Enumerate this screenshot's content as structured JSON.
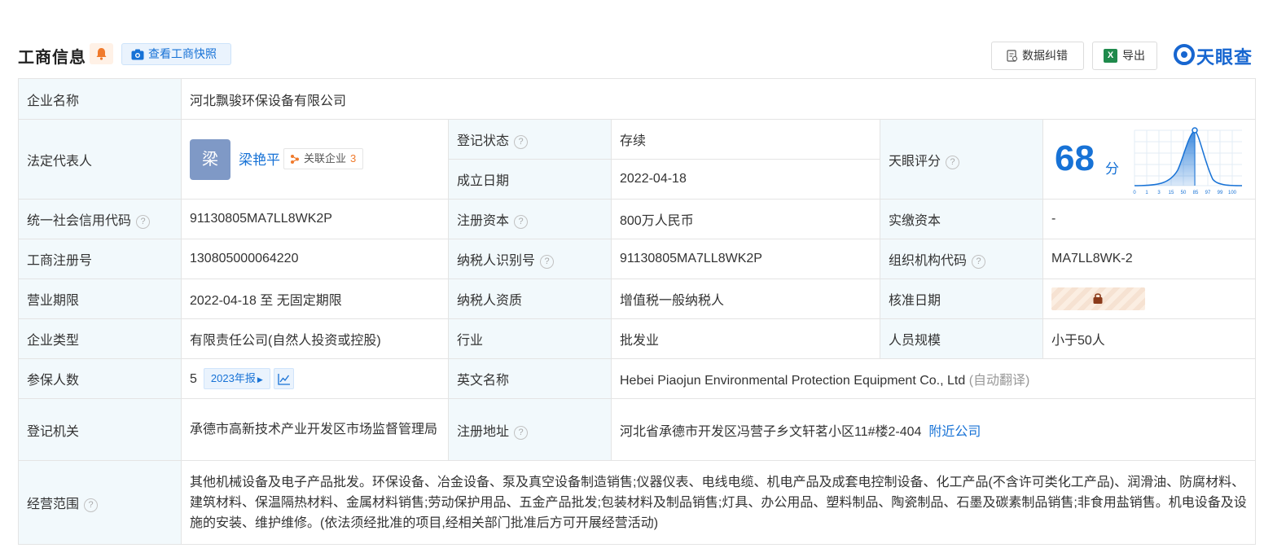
{
  "header": {
    "title": "工商信息",
    "snapshot_button": "查看工商快照",
    "correct_button": "数据纠错",
    "export_button": "导出",
    "export_icon_text": "X",
    "logo_text": "天眼查"
  },
  "company": {
    "name_label": "企业名称",
    "name": "河北飘骏环保设备有限公司",
    "legal_rep_label": "法定代表人",
    "legal_rep_avatar": "梁",
    "legal_rep_name": "梁艳平",
    "related_label": "关联企业",
    "related_count": "3",
    "status_label": "登记状态",
    "status": "存续",
    "found_date_label": "成立日期",
    "found_date": "2022-04-18",
    "score_label": "天眼评分",
    "score": "68",
    "score_unit": "分",
    "score_ticks": [
      "0",
      "1",
      "3",
      "15",
      "50",
      "85",
      "97",
      "99",
      "100"
    ],
    "credit_code_label": "统一社会信用代码",
    "credit_code": "91130805MA7LL8WK2P",
    "reg_capital_label": "注册资本",
    "reg_capital": "800万人民币",
    "paid_capital_label": "实缴资本",
    "paid_capital": "-",
    "reg_no_label": "工商注册号",
    "reg_no": "130805000064220",
    "taxpayer_id_label": "纳税人识别号",
    "taxpayer_id": "91130805MA7LL8WK2P",
    "org_code_label": "组织机构代码",
    "org_code": "MA7LL8WK-2",
    "term_label": "营业期限",
    "term": "2022-04-18 至 无固定期限",
    "taxpayer_type_label": "纳税人资质",
    "taxpayer_type": "增值税一般纳税人",
    "approve_date_label": "核准日期",
    "type_label": "企业类型",
    "type": "有限责任公司(自然人投资或控股)",
    "industry_label": "行业",
    "industry": "批发业",
    "staff_label": "人员规模",
    "staff": "小于50人",
    "insured_label": "参保人数",
    "insured": "5",
    "insured_year": "2023年报",
    "english_name_label": "英文名称",
    "english_name": "Hebei Piaojun Environmental Protection Equipment Co., Ltd",
    "english_name_note": "(自动翻译)",
    "authority_label": "登记机关",
    "authority": "承德市高新技术产业开发区市场监督管理局",
    "address_label": "注册地址",
    "address": "河北省承德市开发区冯营子乡文轩茗小区11#楼2-404",
    "nearby_link": "附近公司",
    "scope_label": "经营范围",
    "scope": "其他机械设备及电子产品批发。环保设备、冶金设备、泵及真空设备制造销售;仪器仪表、电线电缆、机电产品及成套电控制设备、化工产品(不含许可类化工产品)、润滑油、防腐材料、建筑材料、保温隔热材料、金属材料销售;劳动保护用品、五金产品批发;包装材料及制品销售;灯具、办公用品、塑料制品、陶瓷制品、石墨及碳素制品销售;非食用盐销售。机电设备及设施的安装、维护维修。(依法须经批准的项目,经相关部门批准后方可开展经营活动)"
  },
  "help_icon": "?",
  "colors": {
    "accent": "#1772d6",
    "status_green": "#2a9d46",
    "label_bg": "#f2f9fc"
  }
}
